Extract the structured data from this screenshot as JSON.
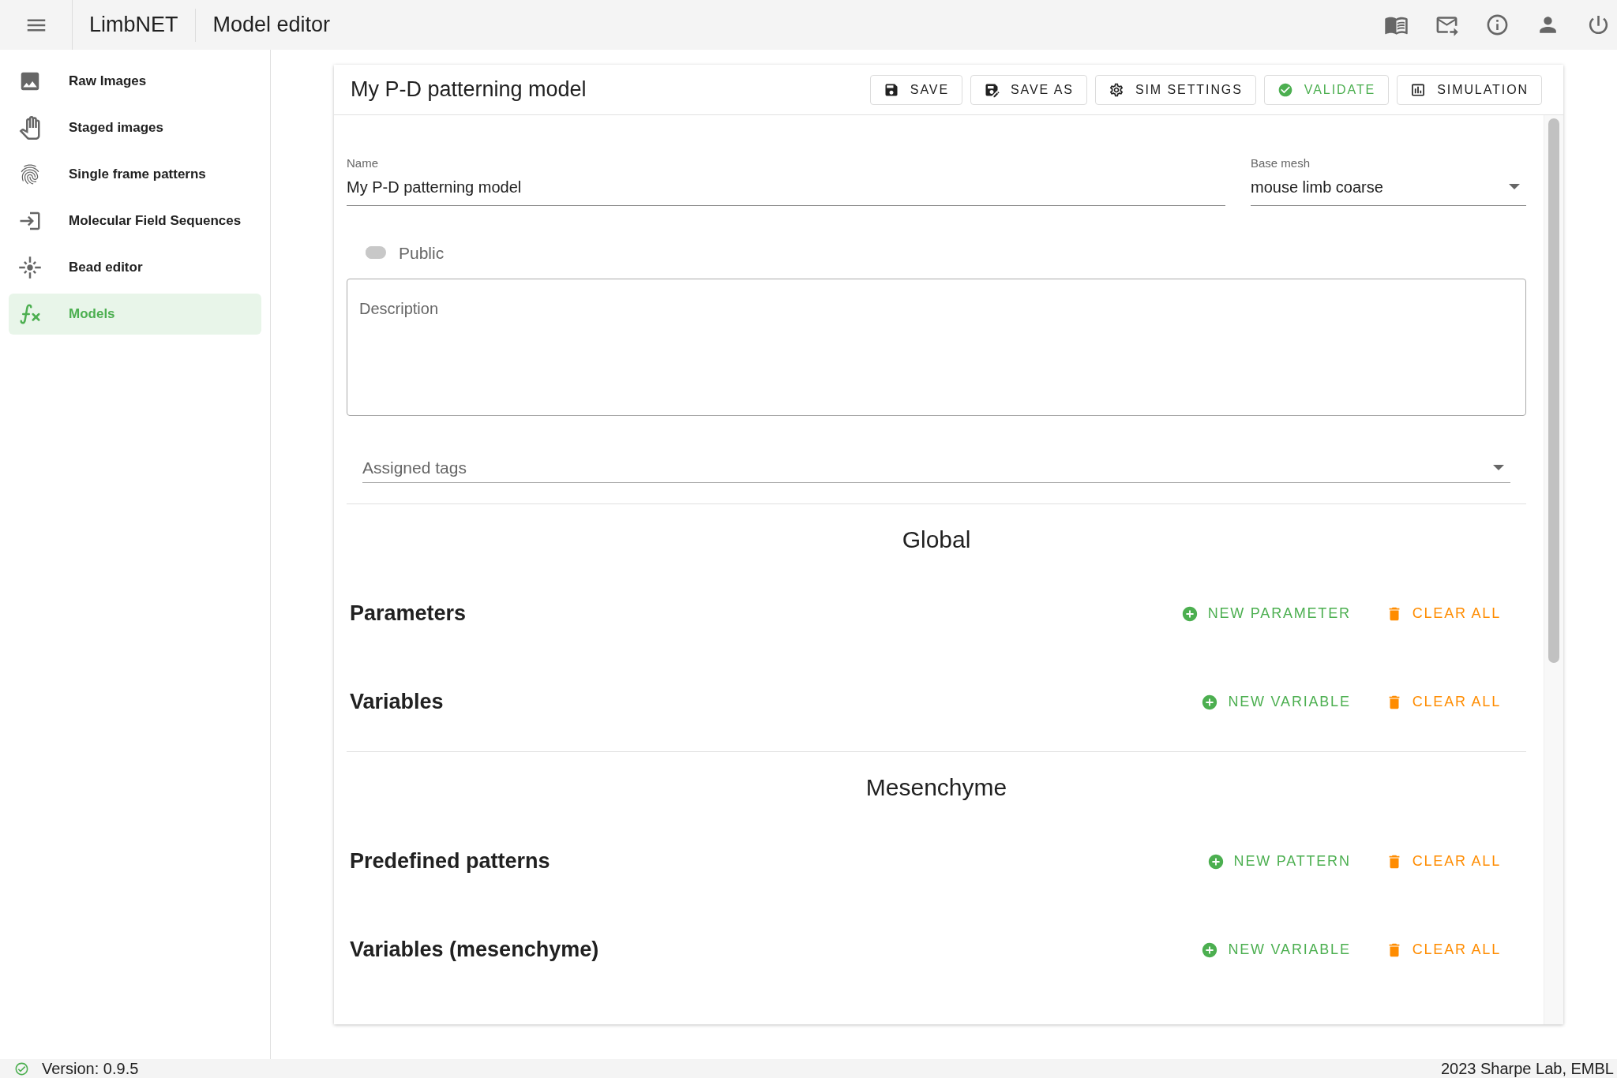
{
  "app_bar": {
    "app_name": "LimbNET",
    "page_title": "Model editor"
  },
  "sidebar": {
    "items": [
      {
        "label": "Raw Images",
        "kind": "image",
        "selected": false
      },
      {
        "label": "Staged images",
        "kind": "hand",
        "selected": false
      },
      {
        "label": "Single frame patterns",
        "kind": "fingerprint",
        "selected": false
      },
      {
        "label": "Molecular Field Sequences",
        "kind": "sequence",
        "selected": false
      },
      {
        "label": "Bead editor",
        "kind": "bead",
        "selected": false
      },
      {
        "label": "Models",
        "kind": "function",
        "selected": true
      }
    ]
  },
  "editor": {
    "title": "My P-D patterning model",
    "toolbar": [
      {
        "label": "SAVE",
        "kind": "save"
      },
      {
        "label": "SAVE AS",
        "kind": "save_as"
      },
      {
        "label": "SIM SETTINGS",
        "kind": "settings"
      },
      {
        "label": "VALIDATE",
        "kind": "validate"
      },
      {
        "label": "SIMULATION",
        "kind": "simulation"
      }
    ],
    "name": {
      "label": "Name",
      "value": "My P-D patterning model"
    },
    "base_mesh": {
      "label": "Base mesh",
      "value": "mouse limb coarse"
    },
    "public": {
      "label": "Public",
      "on": false
    },
    "description": {
      "placeholder": "Description"
    },
    "tags": {
      "placeholder": "Assigned tags"
    },
    "sections": [
      {
        "kind": "heading",
        "title": "Global"
      },
      {
        "kind": "row",
        "title": "Parameters",
        "add": "NEW PARAMETER",
        "clear": "CLEAR ALL"
      },
      {
        "kind": "row",
        "title": "Variables",
        "add": "NEW VARIABLE",
        "clear": "CLEAR ALL"
      },
      {
        "kind": "heading",
        "title": "Mesenchyme"
      },
      {
        "kind": "row",
        "title": "Predefined patterns",
        "add": "NEW PATTERN",
        "clear": "CLEAR ALL"
      },
      {
        "kind": "row",
        "title": "Variables (mesenchyme)",
        "add": "NEW VARIABLE",
        "clear": "CLEAR ALL"
      }
    ]
  },
  "status_bar": {
    "version": "Version: 0.9.5",
    "credit": "2023 Sharpe Lab, EMBL"
  }
}
